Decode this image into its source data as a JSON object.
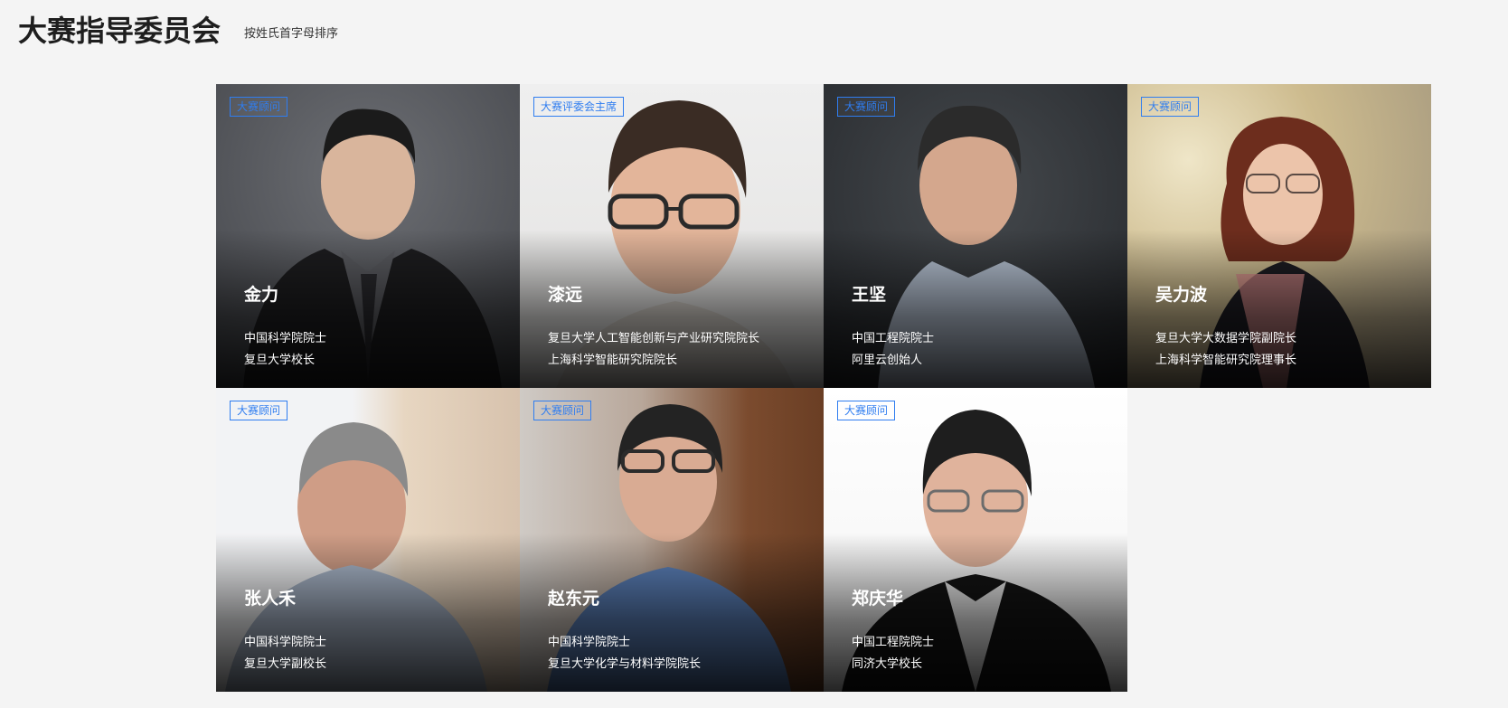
{
  "header": {
    "title": "大赛指导委员会",
    "subtitle": "按姓氏首字母排序"
  },
  "members": [
    {
      "badge": "大赛顾问",
      "name": "金力",
      "line1": "中国科学院院士",
      "line2": "复旦大学校长",
      "bg": "#5e6065"
    },
    {
      "badge": "大赛评委会主席",
      "name": "漆远",
      "line1": "复旦大学人工智能创新与产业研究院院长",
      "line2": "上海科学智能研究院院长",
      "bg": "#e7e6e4"
    },
    {
      "badge": "大赛顾问",
      "name": "王坚",
      "line1": "中国工程院院士",
      "line2": "阿里云创始人",
      "bg": "#2f3337"
    },
    {
      "badge": "大赛顾问",
      "name": "吴力波",
      "line1": "复旦大学大数据学院副院长",
      "line2": "上海科学智能研究院理事长",
      "bg": "#cdbb8e"
    },
    {
      "badge": "大赛顾问",
      "name": "张人禾",
      "line1": "中国科学院院士",
      "line2": "复旦大学副校长",
      "bg": "#e9e9ea"
    },
    {
      "badge": "大赛顾问",
      "name": "赵东元",
      "line1": "中国科学院院士",
      "line2": "复旦大学化学与材料学院院长",
      "bg": "#8a7a6d"
    },
    {
      "badge": "大赛顾问",
      "name": "郑庆华",
      "line1": "中国工程院院士",
      "line2": "同济大学校长",
      "bg": "#f6f6f6"
    }
  ]
}
